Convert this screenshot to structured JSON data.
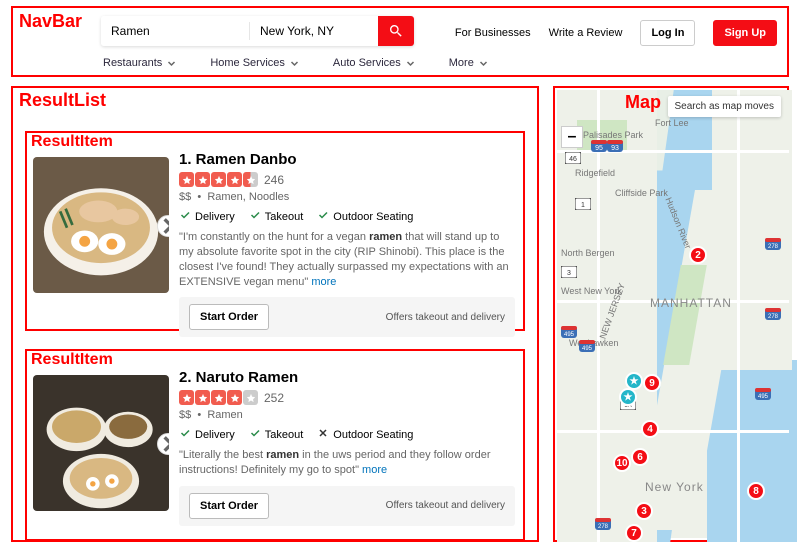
{
  "navbar": {
    "label_overlay": "NavBar",
    "search_term": "Ramen",
    "search_location": "New York, NY",
    "links": {
      "biz": "For Businesses",
      "review": "Write a Review",
      "login": "Log In",
      "signup": "Sign Up"
    },
    "cats": [
      "Restaurants",
      "Home Services",
      "Auto Services",
      "More"
    ]
  },
  "resultlist": {
    "label_overlay": "ResultList",
    "item_label_overlay": "ResultItem",
    "items": [
      {
        "title": "1. Ramen Danbo",
        "rating": 4.5,
        "reviews": "246",
        "price": "$$",
        "categories": "Ramen, Noodles",
        "features": [
          {
            "name": "Delivery",
            "ok": true
          },
          {
            "name": "Takeout",
            "ok": true
          },
          {
            "name": "Outdoor Seating",
            "ok": true
          }
        ],
        "snippet_pre": "\"I'm constantly on the hunt for a vegan ",
        "snippet_bold": "ramen",
        "snippet_post": " that will stand up to my absolute favorite spot in the city (RIP Shinobi). This place is the closest I've found! They actually surpassed my expectations with an EXTENSIVE vegan menu\" ",
        "more": "more",
        "order_btn": "Start Order",
        "order_note": "Offers takeout and delivery"
      },
      {
        "title": "2. Naruto Ramen",
        "rating": 4.0,
        "reviews": "252",
        "price": "$$",
        "categories": "Ramen",
        "features": [
          {
            "name": "Delivery",
            "ok": true
          },
          {
            "name": "Takeout",
            "ok": true
          },
          {
            "name": "Outdoor Seating",
            "ok": false
          }
        ],
        "snippet_pre": "\"Literally the best ",
        "snippet_bold": "ramen",
        "snippet_post": " in the uws period and they follow order instructions! Definitely my go to spot\" ",
        "more": "more",
        "order_btn": "Start Order",
        "order_note": "Offers takeout and delivery"
      }
    ]
  },
  "map": {
    "label_overlay": "Map",
    "search_as_move": "Search as map moves",
    "zoom_out": "–",
    "labels": {
      "palisades": "Palisades Park",
      "fortlee": "Fort Lee",
      "ridgefield": "Ridgefield",
      "cliffside": "Cliffside Park",
      "northbergen": "North Bergen",
      "westny": "West New York",
      "newjersey": "NEW JERSEY",
      "weehawken": "Weehawken",
      "manhattan": "MANHATTAN",
      "newyork": "New York",
      "hudson": "Hudson River"
    },
    "pins": [
      "2",
      "9",
      "4",
      "10",
      "6",
      "3",
      "7",
      "8"
    ],
    "shields": [
      "95",
      "93",
      "46",
      "1",
      "3",
      "495",
      "495",
      "278",
      "278",
      "9A",
      "495",
      "278"
    ]
  }
}
